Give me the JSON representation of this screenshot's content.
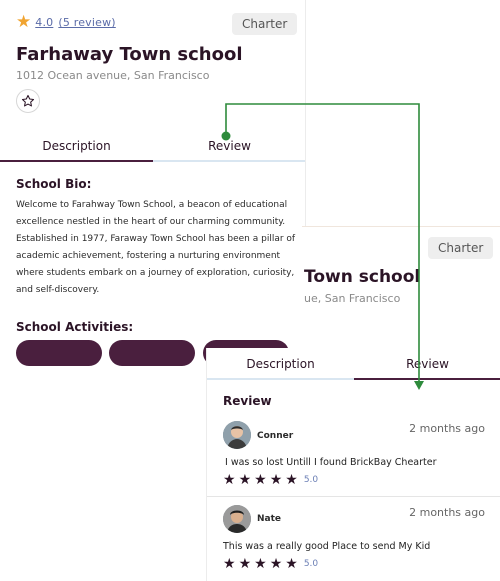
{
  "rating": {
    "score": "4.0",
    "reviews_link": "(5 review)"
  },
  "badge": {
    "label": "Charter"
  },
  "school": {
    "name": "Farhaway Town school",
    "name_partial": "Town school",
    "address": "1012 Ocean avenue, San Francisco",
    "address_partial": "ue, San Francisco"
  },
  "tabs": {
    "description": "Description",
    "review": "Review"
  },
  "bio": {
    "heading": "School Bio:",
    "text": "Welcome to Farahway Town School, a beacon of educational excellence nestled in the heart of our charming community. Established in 1977, Faraway Town School has been a pillar of academic achievement, fostering a nurturing environment where students embark on a journey of exploration, curiosity, and self-discovery."
  },
  "activities": {
    "heading": "School Activities:"
  },
  "reviews": {
    "heading": "Review",
    "items": [
      {
        "name": "Conner",
        "date": "2 months ago",
        "text": "I was so lost  Untill I found BrickBay Chearter",
        "score": "5.0",
        "stars": 5
      },
      {
        "name": "Nate",
        "date": "2 months ago",
        "text": "This was a really good Place to send My Kid",
        "score": "5.0",
        "stars": 5
      }
    ]
  },
  "colors": {
    "brand": "#4a1f3e",
    "accent_arrow": "#2e8b3c",
    "star": "#f0a431",
    "link": "#5b6ca8"
  },
  "icons": {
    "rating_star": "star-filled-icon",
    "favorite": "star-outline-icon",
    "review_star": "star-filled-icon"
  }
}
